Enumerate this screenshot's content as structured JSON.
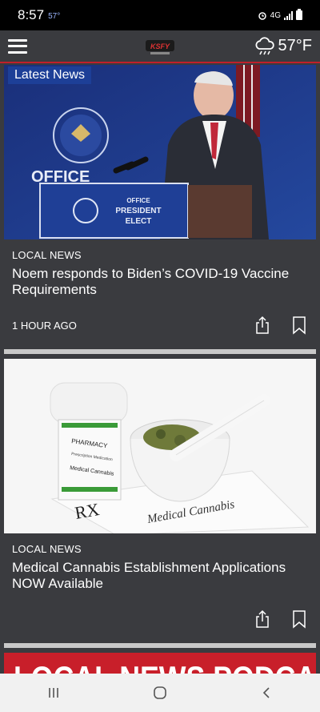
{
  "status_bar": {
    "time": "8:57",
    "temp": "57°",
    "network": "4G"
  },
  "header": {
    "logo_text": "KSFY",
    "weather_temp": "57°F",
    "weather_icon": "cloud-rain-icon"
  },
  "feed": {
    "section_label": "Latest News",
    "articles": [
      {
        "category": "LOCAL NEWS",
        "headline": "Noem responds to Biden’s COVID-19 Vaccine Requirements",
        "time": "1 HOUR AGO",
        "image_text": {
          "office": "OFFICE",
          "podium_line1": "OFFICE",
          "podium_line2": "PRESIDENT",
          "podium_line3": "ELECT"
        }
      },
      {
        "category": "LOCAL NEWS",
        "headline": "Medical Cannabis Establishment Applications NOW Available",
        "time": "",
        "image_text": {
          "bottle_line1": "PHARMACY",
          "bottle_line2": "Prescription Medication",
          "bottle_line3": "Medical Cannabis",
          "rx": "RX",
          "paper_text": "Medical Cannabis"
        }
      }
    ],
    "podcast_banner": "LOCAL NEWS PODCAST"
  },
  "colors": {
    "accent_red": "#c0202a",
    "label_blue": "#1d3f97",
    "card_bg": "#3a3b3f"
  }
}
